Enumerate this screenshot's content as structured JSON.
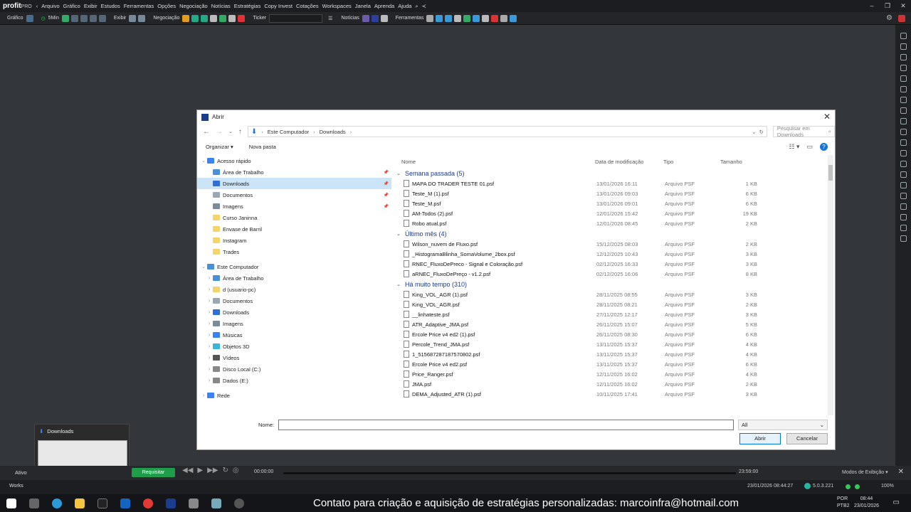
{
  "app": {
    "logo": "profit",
    "logo_suffix": "PRO",
    "menu": [
      "Arquivo",
      "Gráfico",
      "Exibir",
      "Estudos",
      "Ferramentas",
      "Opções",
      "Negociação",
      "Notícias",
      "Estratégias",
      "Copy Invest",
      "Cotações",
      "Workspaces",
      "Janela",
      "Aprenda",
      "Ajuda"
    ]
  },
  "toolbar": {
    "grafico": "Gráfico",
    "interval": "5Min",
    "exibir": "Exibir",
    "negociacao": "Negociação",
    "ticker": "Ticker",
    "noticias": "Notícias",
    "ferramentas": "Ferramentas"
  },
  "dialog": {
    "title": "Abrir",
    "breadcrumb": [
      "Este Computador",
      "Downloads"
    ],
    "search_placeholder": "Pesquisar em Downloads",
    "organize": "Organizar",
    "new_folder": "Nova pasta",
    "tree": [
      {
        "label": "Acesso rápido",
        "level": 0,
        "icon": "star",
        "color": "#3b82f6",
        "expand": "v"
      },
      {
        "label": "Área de Trabalho",
        "level": 1,
        "icon": "desktop",
        "color": "#4a90d9",
        "pin": true
      },
      {
        "label": "Downloads",
        "level": 1,
        "icon": "download",
        "color": "#2f6fd6",
        "pin": true,
        "selected": true
      },
      {
        "label": "Documentos",
        "level": 1,
        "icon": "document",
        "color": "#9aa7b5",
        "pin": true
      },
      {
        "label": "Imagens",
        "level": 1,
        "icon": "image",
        "color": "#7a8b99",
        "pin": true
      },
      {
        "label": "Curso Janinna",
        "level": 1,
        "icon": "folder",
        "color": "#f5d46b"
      },
      {
        "label": "Envase de Barril",
        "level": 1,
        "icon": "folder",
        "color": "#f5d46b"
      },
      {
        "label": "Instagram",
        "level": 1,
        "icon": "folder",
        "color": "#f5d46b"
      },
      {
        "label": "Trades",
        "level": 1,
        "icon": "folder",
        "color": "#f5d46b"
      },
      {
        "label": "Este Computador",
        "level": 0,
        "icon": "computer",
        "color": "#4a90d9",
        "expand": "v"
      },
      {
        "label": "Área de Trabalho",
        "level": 1,
        "icon": "desktop",
        "color": "#4a90d9",
        "expand": ">"
      },
      {
        "label": "d (usuario-pc)",
        "level": 1,
        "icon": "folder",
        "color": "#f5d46b",
        "expand": ">"
      },
      {
        "label": "Documentos",
        "level": 1,
        "icon": "document",
        "color": "#9aa7b5",
        "expand": ">"
      },
      {
        "label": "Downloads",
        "level": 1,
        "icon": "download",
        "color": "#2f6fd6",
        "expand": ">"
      },
      {
        "label": "Imagens",
        "level": 1,
        "icon": "image",
        "color": "#7a8b99",
        "expand": ">"
      },
      {
        "label": "Músicas",
        "level": 1,
        "icon": "music",
        "color": "#3b82f6",
        "expand": ">"
      },
      {
        "label": "Objetos 3D",
        "level": 1,
        "icon": "cube",
        "color": "#38b6d8",
        "expand": ">"
      },
      {
        "label": "Vídeos",
        "level": 1,
        "icon": "video",
        "color": "#555555",
        "expand": ">"
      },
      {
        "label": "Disco Local (C:)",
        "level": 1,
        "icon": "drive",
        "color": "#888888",
        "expand": ">"
      },
      {
        "label": "Dados (E:)",
        "level": 1,
        "icon": "drive",
        "color": "#888888",
        "expand": ">"
      },
      {
        "label": "Rede",
        "level": 0,
        "icon": "network",
        "color": "#3b82f6",
        "expand": ">"
      }
    ],
    "columns": {
      "name": "Nome",
      "date": "Data de modificação",
      "type": "Tipo",
      "size": "Tamanho"
    },
    "groups": [
      {
        "title": "Semana passada (5)",
        "files": [
          {
            "name": "MAPA DO TRADER TESTE 01.psf",
            "date": "13/01/2026 16:11",
            "type": "Arquivo PSF",
            "size": "1 KB"
          },
          {
            "name": "Teste_M (1).psf",
            "date": "13/01/2026 09:03",
            "type": "Arquivo PSF",
            "size": "6 KB"
          },
          {
            "name": "Teste_M.psf",
            "date": "13/01/2026 09:01",
            "type": "Arquivo PSF",
            "size": "6 KB"
          },
          {
            "name": "AM-Todos (2).psf",
            "date": "12/01/2026 15:42",
            "type": "Arquivo PSF",
            "size": "19 KB"
          },
          {
            "name": "Robo atual.psf",
            "date": "12/01/2026 08:45",
            "type": "Arquivo PSF",
            "size": "2 KB"
          }
        ]
      },
      {
        "title": "Último mês (4)",
        "files": [
          {
            "name": "Wilson_nuvem de Fluxo.psf",
            "date": "15/12/2025 08:03",
            "type": "Arquivo PSF",
            "size": "2 KB"
          },
          {
            "name": "_HistogramaBlinha_SomaVolume_2box.psf",
            "date": "12/12/2025 10:43",
            "type": "Arquivo PSF",
            "size": "3 KB"
          },
          {
            "name": "RNEC_FluxoDePreco - Signal e Coloração.psf",
            "date": "02/12/2025 16:33",
            "type": "Arquivo PSF",
            "size": "3 KB"
          },
          {
            "name": "aRNEC_FluxoDePreço - v1.2.psf",
            "date": "02/12/2025 16:06",
            "type": "Arquivo PSF",
            "size": "8 KB"
          }
        ]
      },
      {
        "title": "Há muito tempo (310)",
        "files": [
          {
            "name": "King_VOL_AGR (1).psf",
            "date": "28/11/2025 08:55",
            "type": "Arquivo PSF",
            "size": "3 KB"
          },
          {
            "name": "King_VOL_AGR.psf",
            "date": "28/11/2025 08:21",
            "type": "Arquivo PSF",
            "size": "2 KB"
          },
          {
            "name": "__linhateste.psf",
            "date": "27/11/2025 12:17",
            "type": "Arquivo PSF",
            "size": "3 KB"
          },
          {
            "name": "ATR_Adaptive_JMA.psf",
            "date": "26/11/2025 15:07",
            "type": "Arquivo PSF",
            "size": "5 KB"
          },
          {
            "name": "Ercole Price v4 ed2 (1).psf",
            "date": "26/11/2025 08:30",
            "type": "Arquivo PSF",
            "size": "6 KB"
          },
          {
            "name": "Percole_Trend_JMA.psf",
            "date": "13/11/2025 15:37",
            "type": "Arquivo PSF",
            "size": "4 KB"
          },
          {
            "name": "1_515687287187570802.psf",
            "date": "13/11/2025 15:37",
            "type": "Arquivo PSF",
            "size": "4 KB"
          },
          {
            "name": "Ercole Price v4 ed2.psf",
            "date": "13/11/2025 15:37",
            "type": "Arquivo PSF",
            "size": "6 KB"
          },
          {
            "name": "Price_Ranger.psf",
            "date": "12/11/2025 16:02",
            "type": "Arquivo PSF",
            "size": "4 KB"
          },
          {
            "name": "JMA.psf",
            "date": "12/11/2025 16:02",
            "type": "Arquivo PSF",
            "size": "2 KB"
          },
          {
            "name": "DEMA_Adjusted_ATR (1).psf",
            "date": "10/11/2025 17:41",
            "type": "Arquivo PSF",
            "size": "3 KB"
          }
        ]
      }
    ],
    "name_label": "Nome:",
    "name_value": "",
    "filter_value": "All",
    "open_label": "Abrir",
    "cancel_label": "Cancelar"
  },
  "thumbnail": {
    "title": "Downloads"
  },
  "player": {
    "ativo": "Ativo",
    "request": "Requisitar",
    "time_start": "00:00:00",
    "time_end": "23:59:00",
    "modes": "Modos de Exibição"
  },
  "status": {
    "workspace": "Works",
    "datetime": "23/01/2026 08:44:27",
    "version": "5.0.3.221",
    "zoom": "100%"
  },
  "taskbar": {
    "contact": "Contato para criação e aquisição de estratégias personalizadas: marcoinfra@hotmail.com",
    "lang1": "POR",
    "lang2": "PTB2",
    "time": "08:44",
    "date": "23/01/2026"
  },
  "colors": {
    "accent": "#0078d7",
    "selected": "#cce4f7",
    "request_button": "#1e9e4a",
    "group_title": "#1e3a8a"
  }
}
